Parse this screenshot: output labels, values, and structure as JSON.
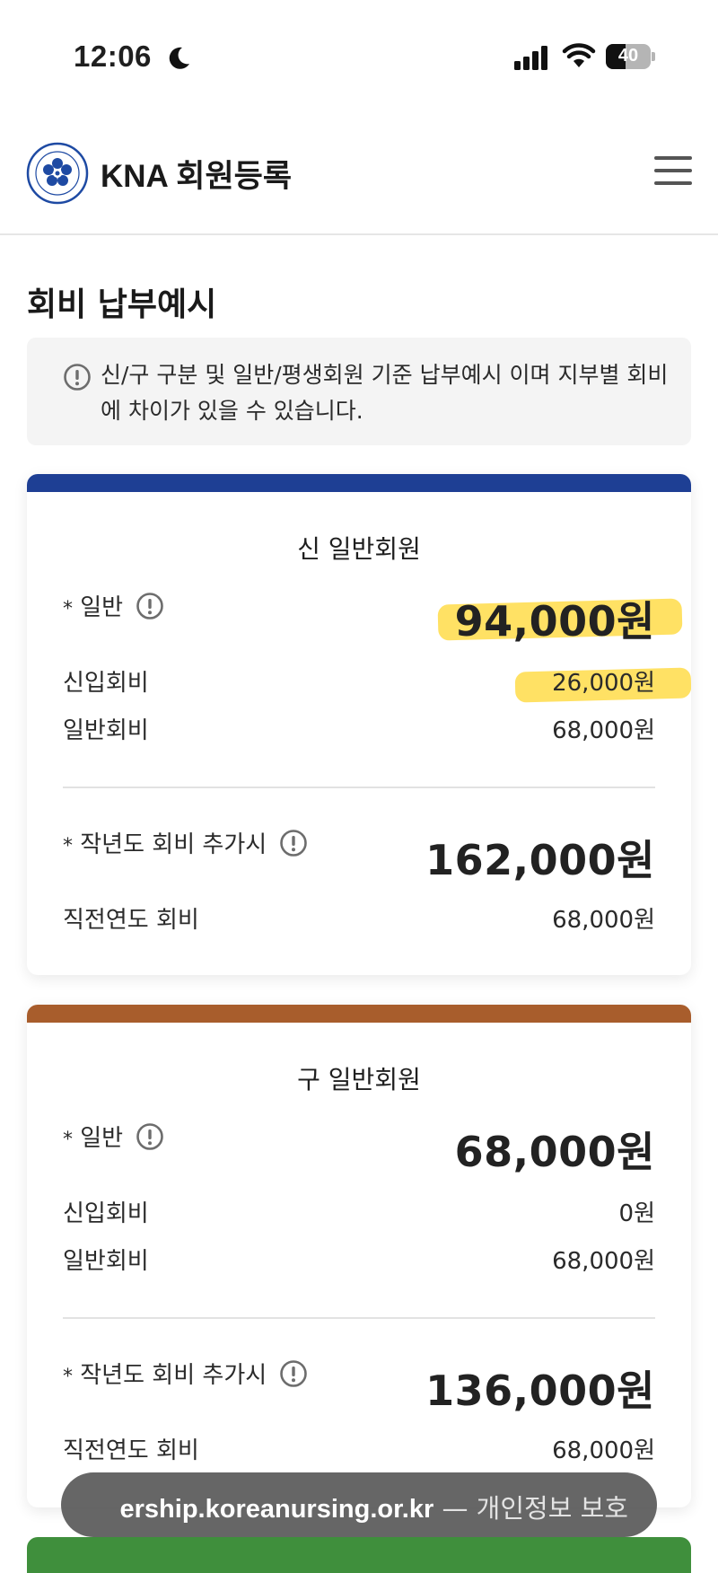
{
  "status_bar": {
    "time": "12:06",
    "battery": "40",
    "icons": [
      "moon-icon",
      "signal-icon",
      "wifi-icon",
      "battery-icon"
    ]
  },
  "header": {
    "brand": "KNA 회원등록",
    "logo_icon": "kna-logo-icon",
    "menu_icon": "hamburger-menu-icon"
  },
  "page": {
    "title": "회비 납부예시",
    "notice": "신/구 구분 및 일반/평생회원 기준 납부예시 이며 지부별 회비에 차이가 있을 수 있습니다."
  },
  "cards": [
    {
      "title": "신 일반회원",
      "accent": "#1e3f94",
      "general_label": "일반",
      "general_total": "94,000원",
      "rows": [
        {
          "label": "신입회비",
          "value": "26,000원"
        },
        {
          "label": "일반회비",
          "value": "68,000원"
        }
      ],
      "prev_label": "작년도 회비 추가시",
      "prev_total": "162,000원",
      "prev_row": {
        "label": "직전연도 회비",
        "value": "68,000원"
      }
    },
    {
      "title": "구 일반회원",
      "accent": "#a85d2c",
      "general_label": "일반",
      "general_total": "68,000원",
      "rows": [
        {
          "label": "신입회비",
          "value": "0원"
        },
        {
          "label": "일반회비",
          "value": "68,000원"
        }
      ],
      "prev_label": "작년도 회비 추가시",
      "prev_total": "136,000원",
      "prev_row": {
        "label": "직전연도 회비",
        "value": "68,000원"
      }
    }
  ],
  "url_bar": {
    "url": "ership.koreanursing.or.kr",
    "suffix": " — 개인정보 보호"
  },
  "colors": {
    "card1_accent": "#1e3f94",
    "card2_accent": "#a85d2c",
    "card3_accent": "#3f8f3c",
    "highlight": "#ffd628"
  }
}
